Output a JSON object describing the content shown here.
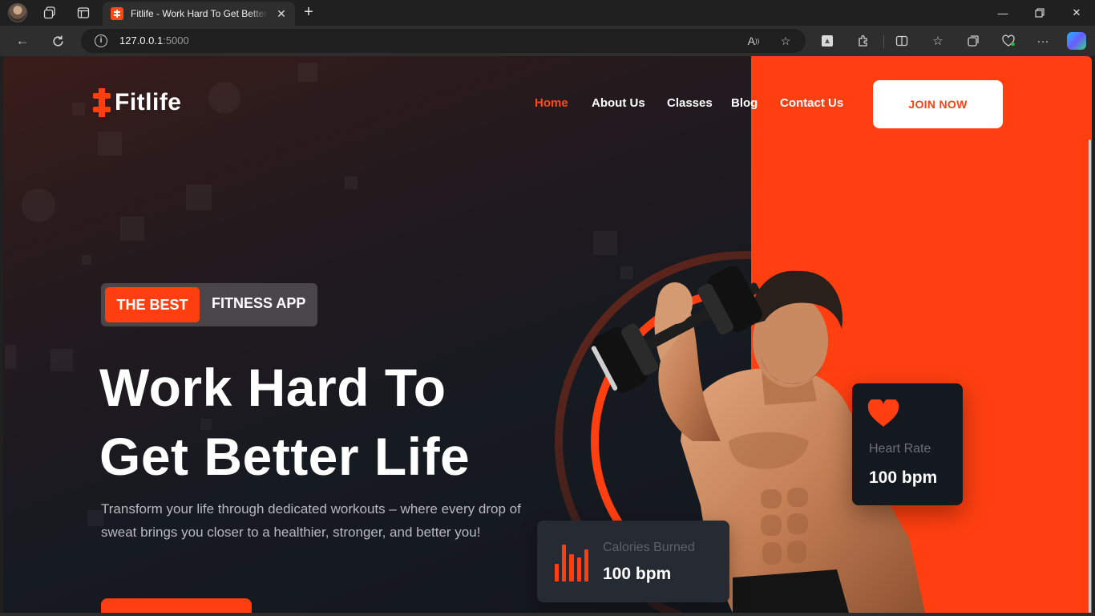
{
  "browser": {
    "tab_title": "Fitlife - Work Hard To Get Better Life",
    "new_tab_symbol": "+",
    "url_host": "127.0.0.1",
    "url_port": ":5000"
  },
  "site": {
    "logo": "Fitlife",
    "nav": [
      {
        "label": "Home",
        "active": true
      },
      {
        "label": "About Us",
        "active": false
      },
      {
        "label": "Classes",
        "active": false
      },
      {
        "label": "Blog",
        "active": false
      },
      {
        "label": "Contact Us",
        "active": false
      }
    ],
    "join_button": "JOIN NOW"
  },
  "hero": {
    "badge_highlight": "THE BEST",
    "badge_rest": "FITNESS APP",
    "headline_line1": "Work Hard To",
    "headline_line2": "Get Better Life",
    "subtext": "Transform your life through dedicated workouts – where every drop of sweat brings you closer to a healthier, stronger, and better you!"
  },
  "stats": {
    "heart_rate": {
      "label": "Heart Rate",
      "value": "100 bpm"
    },
    "calories": {
      "label": "Calories Burned",
      "value": "100 bpm"
    }
  },
  "colors": {
    "accent": "#ff3f10",
    "dark_bg": "#161a21",
    "card_dark": "#14181f"
  }
}
